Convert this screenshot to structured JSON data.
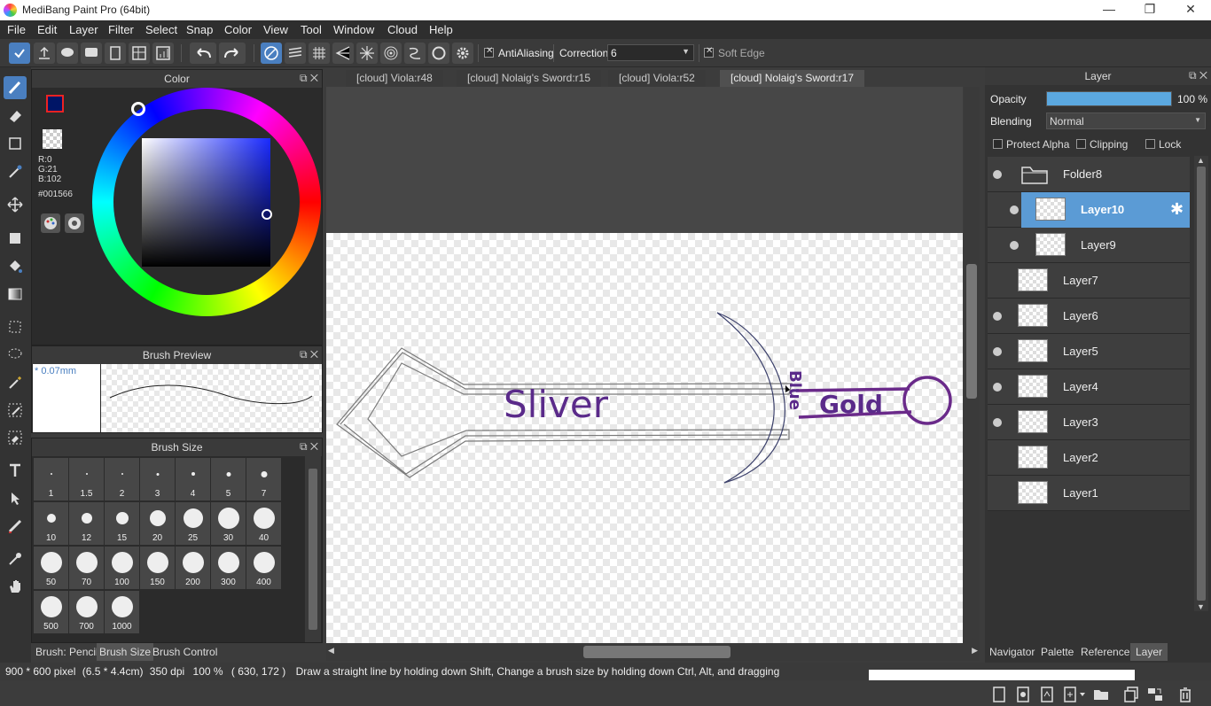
{
  "window": {
    "title": "MediBang Paint Pro (64bit)",
    "minimize": "—",
    "restore": "❐",
    "close": "✕"
  },
  "menu": [
    "File",
    "Edit",
    "Layer",
    "Filter",
    "Select",
    "Snap",
    "Color",
    "View",
    "Tool",
    "Window",
    "Cloud",
    "Help"
  ],
  "toolbar": {
    "antialiasing": "AntiAliasing",
    "correction_label": "Correction",
    "correction_value": "6",
    "soft_edge": "Soft Edge"
  },
  "color_panel": {
    "title": "Color",
    "r": "R:0",
    "g": "G:21",
    "b": "B:102",
    "hex": "#001566",
    "primary": "#001566"
  },
  "brush_preview": {
    "title": "Brush Preview",
    "size": "* 0.07mm"
  },
  "brush_size": {
    "title": "Brush Size",
    "sizes": [
      "1",
      "1.5",
      "2",
      "3",
      "4",
      "5",
      "7",
      "10",
      "12",
      "15",
      "20",
      "25",
      "30",
      "40",
      "50",
      "70",
      "100",
      "150",
      "200",
      "300",
      "400",
      "500",
      "700",
      "1000"
    ]
  },
  "bottom_tabs": [
    "Brush: Pencil",
    "Brush Size",
    "Brush Control"
  ],
  "tabs": [
    "[cloud] Viola:r48",
    "[cloud] Nolaig's Sword:r15",
    "[cloud] Viola:r52",
    "[cloud] Nolaig's Sword:r17"
  ],
  "canvas_text": {
    "sliver": "Sliver",
    "blue": "Blue",
    "gold": "Gold"
  },
  "layer_panel": {
    "title": "Layer",
    "opacity_label": "Opacity",
    "opacity_value": "100 %",
    "opacity": 1.0,
    "blending_label": "Blending",
    "blending_value": "Normal",
    "protect_alpha": "Protect Alpha",
    "clipping": "Clipping",
    "lock": "Lock",
    "layers": [
      "Folder8",
      "Layer10",
      "Layer9",
      "Layer7",
      "Layer6",
      "Layer5",
      "Layer4",
      "Layer3",
      "Layer2",
      "Layer1"
    ]
  },
  "right_tabs": [
    "Navigator",
    "Palette",
    "Reference",
    "Layer"
  ],
  "status": {
    "size": "900 * 600 pixel",
    "dims": "(6.5 * 4.4cm)",
    "dpi": "350 dpi",
    "zoom": "100 %",
    "coords": "( 630, 172 )",
    "hint": "Draw a straight line by holding down Shift, Change a brush size by holding down Ctrl, Alt, and dragging"
  }
}
